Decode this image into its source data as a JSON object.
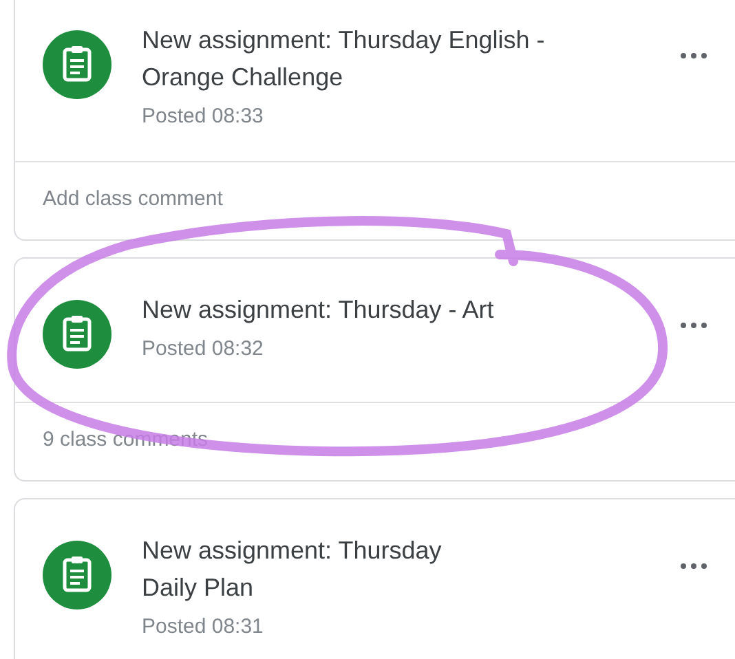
{
  "posts": [
    {
      "title": [
        "New assignment: Thursday English -",
        "Orange Challenge"
      ],
      "posted": "Posted 08:33",
      "comments": "Add class comment",
      "circled": false
    },
    {
      "title": [
        "New assignment: Thursday - Art"
      ],
      "posted": "Posted 08:32",
      "comments": "9 class comments",
      "circled": true
    },
    {
      "title": [
        "New assignment: Thursday",
        "Daily Plan"
      ],
      "posted": "Posted 08:31",
      "circled": false
    }
  ]
}
